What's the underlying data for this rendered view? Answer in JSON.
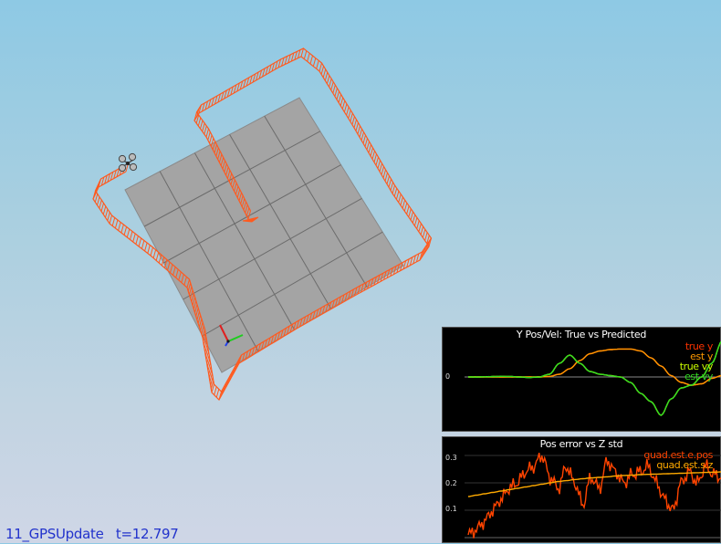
{
  "status": {
    "scenario": "11_GPSUpdate",
    "time_label": "t=12.797"
  },
  "colors": {
    "trajectory": "#ff5a1f",
    "floor": "#a4a4a4",
    "grid": "#6a6a6a",
    "true_y": "#ff3300",
    "est_y": "#ff9900",
    "true_vy": "#ccff00",
    "est_vy": "#33dd22",
    "pos_err": "#ff4400",
    "std_z": "#ffaa00"
  },
  "chart_data": [
    {
      "type": "line",
      "title": "Y Pos/Vel: True vs Predicted",
      "y_ticks": [
        "0"
      ],
      "legend_placement": "top-right",
      "series": [
        {
          "name": "true y",
          "values": [
            0,
            0,
            0,
            0,
            0,
            0,
            0,
            0,
            0.02,
            0.1,
            0.3,
            0.6,
            0.85,
            0.95,
            1.0,
            1.02,
            1.02,
            0.95,
            0.7,
            0.4,
            0.05,
            -0.2,
            -0.3,
            -0.25,
            -0.05,
            0.05
          ]
        },
        {
          "name": "est y",
          "values": [
            0,
            0,
            0,
            0,
            0,
            0,
            0,
            0,
            0.02,
            0.1,
            0.3,
            0.6,
            0.85,
            0.95,
            1.0,
            1.02,
            1.02,
            0.95,
            0.7,
            0.4,
            0.05,
            -0.2,
            -0.3,
            -0.25,
            -0.05,
            0.05
          ]
        },
        {
          "name": "true vy",
          "values": [
            0,
            0,
            0.01,
            0.02,
            0.02,
            0,
            -0.02,
            0,
            0.1,
            0.5,
            0.8,
            0.5,
            0.2,
            0.1,
            0.05,
            0,
            -0.2,
            -0.6,
            -0.9,
            -1.4,
            -0.8,
            -0.4,
            -0.3,
            0,
            0.5,
            1.3
          ]
        },
        {
          "name": "est vy",
          "values": [
            0,
            0,
            0.01,
            0.02,
            0.02,
            0,
            -0.02,
            0,
            0.1,
            0.5,
            0.8,
            0.5,
            0.2,
            0.1,
            0.05,
            0,
            -0.2,
            -0.6,
            -0.9,
            -1.4,
            -0.8,
            -0.4,
            -0.3,
            0,
            0.5,
            1.3
          ]
        }
      ]
    },
    {
      "type": "line",
      "title": "Pos error vs Z std",
      "y_ticks": [
        "0.3",
        "0.2",
        "0.1"
      ],
      "ylim": [
        0,
        0.33
      ],
      "legend_placement": "top-right",
      "series": [
        {
          "name": "quad.est.e.pos",
          "values": [
            0.01,
            0.03,
            0.06,
            0.1,
            0.14,
            0.18,
            0.2,
            0.24,
            0.26,
            0.3,
            0.22,
            0.18,
            0.26,
            0.2,
            0.12,
            0.22,
            0.18,
            0.28,
            0.24,
            0.2,
            0.23,
            0.24,
            0.26,
            0.2,
            0.14,
            0.1,
            0.2,
            0.24,
            0.2,
            0.26,
            0.23,
            0.22
          ]
        },
        {
          "name": "quad.est.s.z",
          "values": [
            0.15,
            0.155,
            0.16,
            0.165,
            0.17,
            0.175,
            0.18,
            0.185,
            0.19,
            0.195,
            0.2,
            0.205,
            0.208,
            0.212,
            0.215,
            0.218,
            0.22,
            0.222,
            0.225,
            0.227,
            0.228,
            0.23,
            0.231,
            0.232,
            0.233,
            0.234,
            0.235,
            0.236,
            0.237,
            0.238,
            0.239,
            0.24
          ]
        }
      ]
    }
  ]
}
